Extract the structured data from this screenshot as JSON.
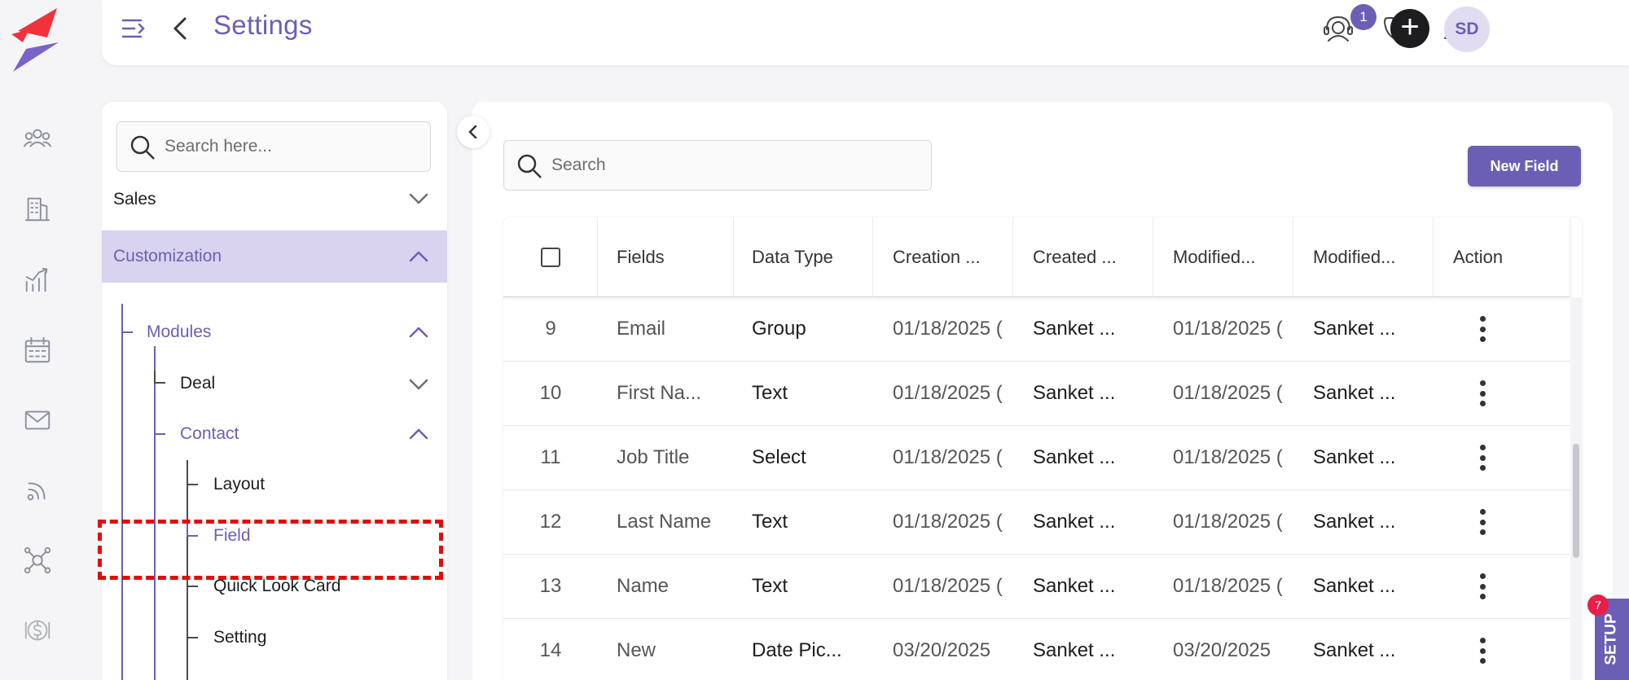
{
  "header": {
    "title": "Settings",
    "notifications_count": "1",
    "avatar_initials": "SD"
  },
  "rail": {
    "icons": [
      "contacts-icon",
      "company-icon",
      "analytics-icon",
      "calendar-icon",
      "mail-icon",
      "feed-icon",
      "integration-icon",
      "billing-icon"
    ]
  },
  "nav": {
    "search_placeholder": "Search here...",
    "sales_label": "Sales",
    "customization_label": "Customization",
    "modules_label": "Modules",
    "deal_label": "Deal",
    "contact_label": "Contact",
    "layout_label": "Layout",
    "field_label": "Field",
    "quick_look_label": "Quick Look Card",
    "setting_label": "Setting"
  },
  "main": {
    "search_placeholder": "Search",
    "new_field_label": "New Field",
    "columns": [
      "Fields",
      "Data Type",
      "Creation ...",
      "Created ...",
      "Modified...",
      "Modified...",
      "Action"
    ],
    "rows": [
      {
        "num": "9",
        "field": "Email",
        "type": "Group",
        "created_on": "01/18/2025 (",
        "created_by": "Sanket ...",
        "modified_on": "01/18/2025 (",
        "modified_by": "Sanket ..."
      },
      {
        "num": "10",
        "field": "First Na...",
        "type": "Text",
        "created_on": "01/18/2025 (",
        "created_by": "Sanket ...",
        "modified_on": "01/18/2025 (",
        "modified_by": "Sanket ..."
      },
      {
        "num": "11",
        "field": "Job Title",
        "type": "Select",
        "created_on": "01/18/2025 (",
        "created_by": "Sanket ...",
        "modified_on": "01/18/2025 (",
        "modified_by": "Sanket ..."
      },
      {
        "num": "12",
        "field": "Last Name",
        "type": "Text",
        "created_on": "01/18/2025 (",
        "created_by": "Sanket ...",
        "modified_on": "01/18/2025 (",
        "modified_by": "Sanket ..."
      },
      {
        "num": "13",
        "field": "Name",
        "type": "Text",
        "created_on": "01/18/2025 (",
        "created_by": "Sanket ...",
        "modified_on": "01/18/2025 (",
        "modified_by": "Sanket ..."
      },
      {
        "num": "14",
        "field": "New",
        "type": "Date Pic...",
        "created_on": "03/20/2025",
        "created_by": "Sanket ...",
        "modified_on": "03/20/2025",
        "modified_by": "Sanket ..."
      }
    ]
  },
  "setup": {
    "label": "SETUP",
    "badge": "7"
  },
  "colors": {
    "accent": "#6b5fb5",
    "active_bg": "#d9d3ef",
    "highlight": "#e10d0d",
    "logo_red": "#f0323c"
  }
}
